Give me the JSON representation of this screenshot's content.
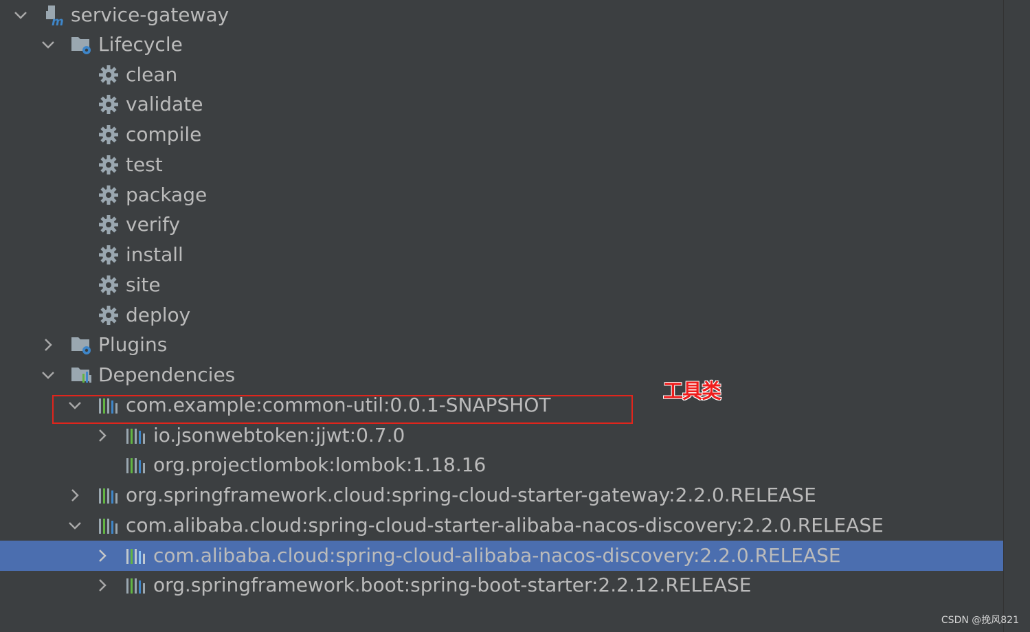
{
  "tree": {
    "root": {
      "label": "service-gateway",
      "icon": "maven-module-icon"
    },
    "lifecycle": {
      "label": "Lifecycle",
      "icon": "lifecycle-folder-icon",
      "goals": [
        "clean",
        "validate",
        "compile",
        "test",
        "package",
        "verify",
        "install",
        "site",
        "deploy"
      ]
    },
    "plugins": {
      "label": "Plugins",
      "icon": "plugins-folder-icon"
    },
    "dependencies": {
      "label": "Dependencies",
      "icon": "dependencies-folder-icon",
      "items": [
        "com.example:common-util:0.0.1-SNAPSHOT",
        "io.jsonwebtoken:jjwt:0.7.0",
        "org.projectlombok:lombok:1.18.16",
        "org.springframework.cloud:spring-cloud-starter-gateway:2.2.0.RELEASE",
        "com.alibaba.cloud:spring-cloud-starter-alibaba-nacos-discovery:2.2.0.RELEASE",
        "com.alibaba.cloud:spring-cloud-alibaba-nacos-discovery:2.2.0.RELEASE",
        "org.springframework.boot:spring-boot-starter:2.2.12.RELEASE"
      ]
    }
  },
  "annotation": {
    "text": "工具类"
  },
  "watermark": {
    "text": "CSDN @挽风821"
  },
  "colors": {
    "background": "#3c3f41",
    "text": "#bbbbbb",
    "selection": "#4b6eaf",
    "annotation_red": "#e0251c"
  }
}
